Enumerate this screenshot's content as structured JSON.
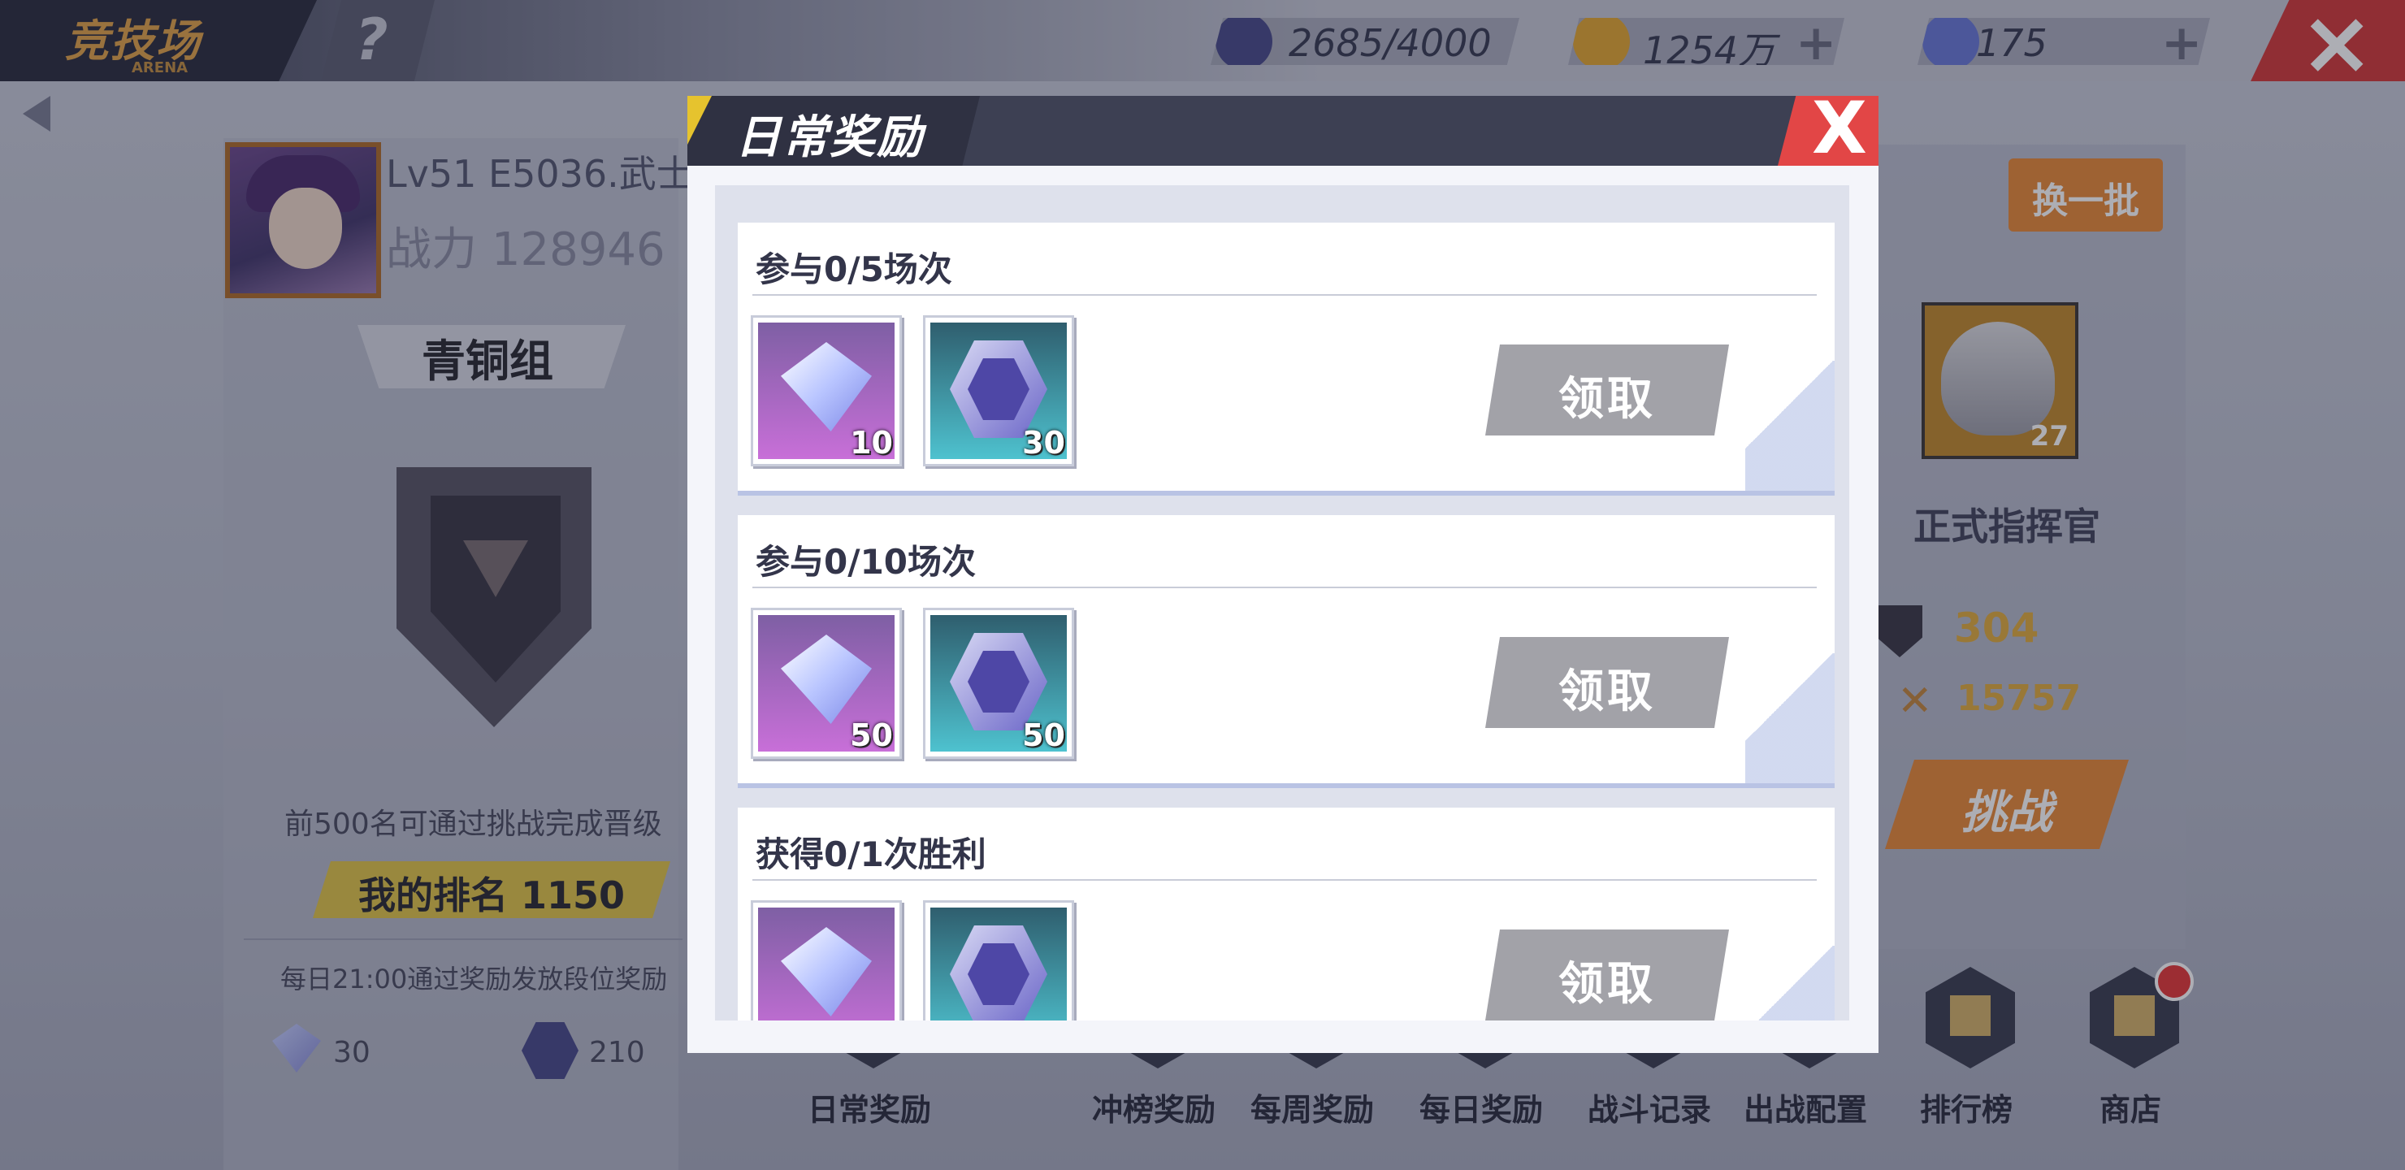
{
  "header": {
    "title": "竞技场",
    "subtitle": "ARENA",
    "help": "?",
    "stamina": "2685/4000",
    "gold": "1254万",
    "gems": "175"
  },
  "player": {
    "level": "Lv51",
    "name": "E5036.武士",
    "power_label": "战力",
    "power": "128946",
    "group": "青铜组",
    "note": "前500名可通过挑战完成晋级",
    "rank_text": "我的排名 1150",
    "reward_note": "每日21:00通过奖励发放段位奖励",
    "reward_gem": "30",
    "reward_coin": "210"
  },
  "opponent": {
    "refresh": "换一批",
    "level": "27",
    "rank_title": "正式指挥官",
    "power": "304",
    "score": "15757",
    "challenge": "挑战"
  },
  "nav": [
    {
      "label": "日常奖励"
    },
    {
      "label": "冲榜奖励"
    },
    {
      "label": "每周奖励"
    },
    {
      "label": "每日奖励"
    },
    {
      "label": "战斗记录"
    },
    {
      "label": "出战配置"
    },
    {
      "label": "排行榜"
    },
    {
      "label": "商店"
    }
  ],
  "modal": {
    "title": "日常奖励",
    "close": "X",
    "tasks": [
      {
        "title": "参与0/5场次",
        "gem_qty": "10",
        "coin_qty": "30",
        "claim": "领取"
      },
      {
        "title": "参与0/10场次",
        "gem_qty": "50",
        "coin_qty": "50",
        "claim": "领取"
      },
      {
        "title": "获得0/1次胜利",
        "gem_qty": "",
        "coin_qty": "",
        "claim": "领取"
      }
    ]
  },
  "colors": {
    "accent": "#e98a3a",
    "close_red": "#e24646",
    "claim_disabled": "#a2a2a8",
    "modal_header": "#3d4053"
  }
}
